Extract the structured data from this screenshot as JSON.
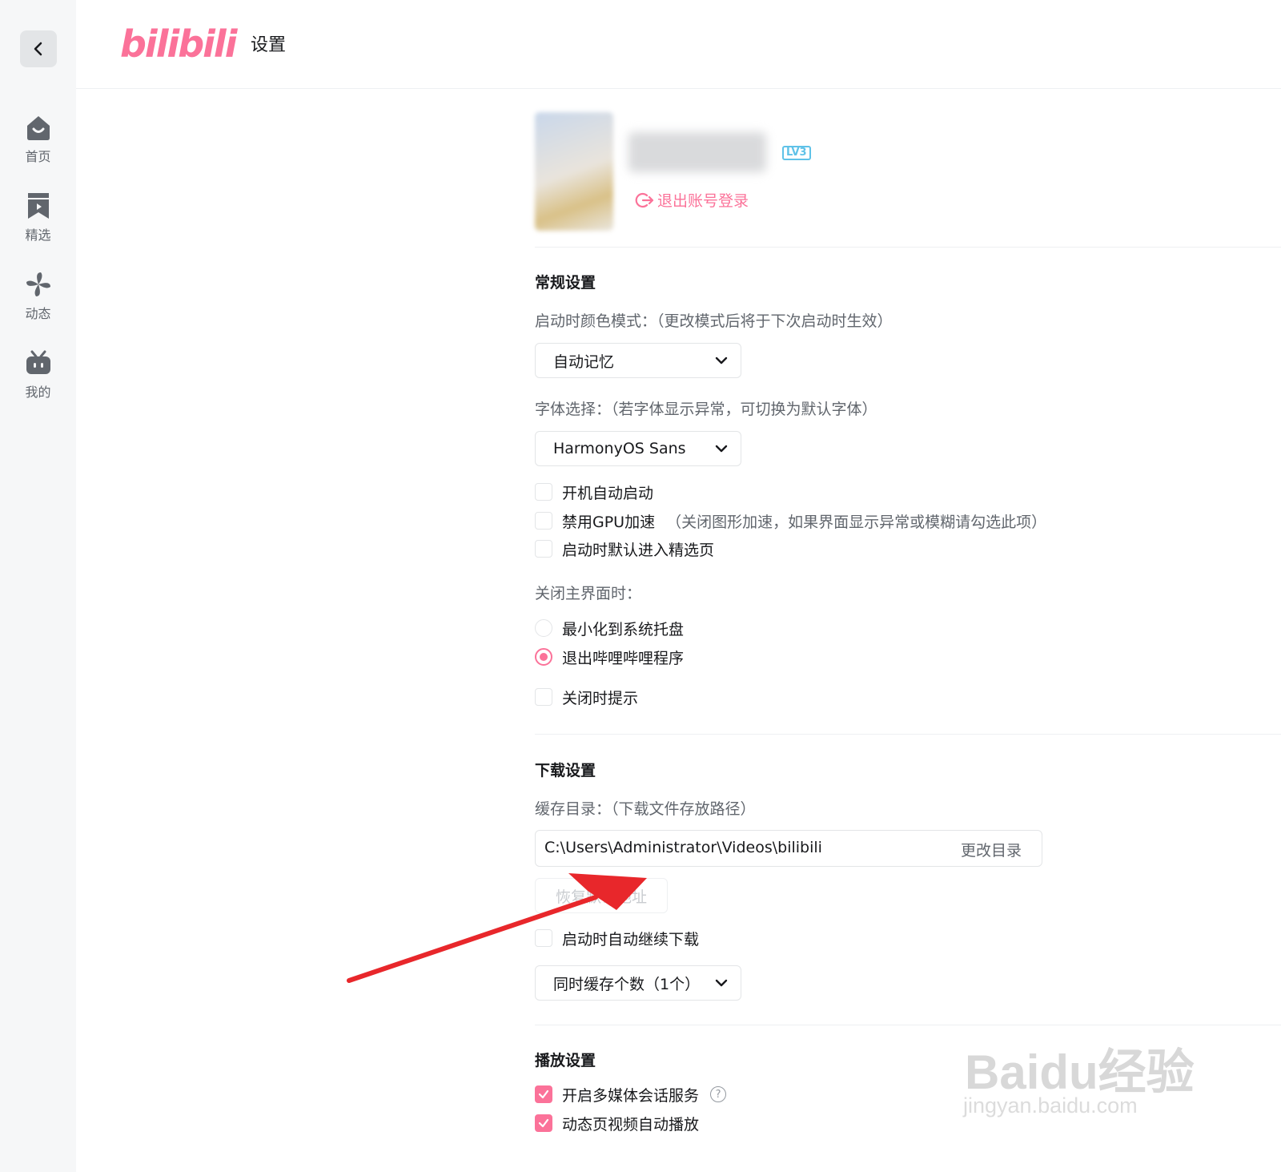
{
  "app": {
    "logo_text": "bilibili",
    "page_title": "设置",
    "accent_color": "#fb7299"
  },
  "sidebar": {
    "items": [
      {
        "label": "首页",
        "icon": "home-icon"
      },
      {
        "label": "精选",
        "icon": "bookmark-icon"
      },
      {
        "label": "动态",
        "icon": "pinwheel-icon"
      },
      {
        "label": "我的",
        "icon": "tv-icon"
      }
    ]
  },
  "account": {
    "level": "LV3",
    "logout_label": "退出账号登录"
  },
  "general": {
    "title": "常规设置",
    "color_mode_label": "启动时颜色模式：（更改模式后将于下次启动时生效）",
    "color_mode_value": "自动记忆",
    "font_label": "字体选择：（若字体显示异常，可切换为默认字体）",
    "font_value": "HarmonyOS Sans",
    "auto_start": {
      "label": "开机自动启动",
      "checked": false
    },
    "disable_gpu": {
      "label": "禁用GPU加速",
      "hint": "（关闭图形加速，如果界面显示异常或模糊请勾选此项）",
      "checked": false
    },
    "default_featured": {
      "label": "启动时默认进入精选页",
      "checked": false
    },
    "close_label": "关闭主界面时：",
    "close_minimize": {
      "label": "最小化到系统托盘",
      "checked": false
    },
    "close_exit": {
      "label": "退出哔哩哔哩程序",
      "checked": true
    },
    "close_prompt": {
      "label": "关闭时提示",
      "checked": false
    }
  },
  "download": {
    "title": "下载设置",
    "cache_label": "缓存目录：（下载文件存放路径）",
    "cache_path": "C:\\Users\\Administrator\\Videos\\bilibili",
    "change_dir_label": "更改目录",
    "restore_label": "恢复默认地址",
    "auto_resume": {
      "label": "启动时自动继续下载",
      "checked": false
    },
    "concurrent_value": "同时缓存个数（1个）"
  },
  "playback": {
    "title": "播放设置",
    "media_session": {
      "label": "开启多媒体会话服务",
      "checked": true,
      "help": "?"
    },
    "autoplay": {
      "label": "动态页视频自动播放",
      "checked": true
    }
  },
  "watermark": {
    "text": "Baidu经验",
    "url": "jingyan.baidu.com"
  }
}
